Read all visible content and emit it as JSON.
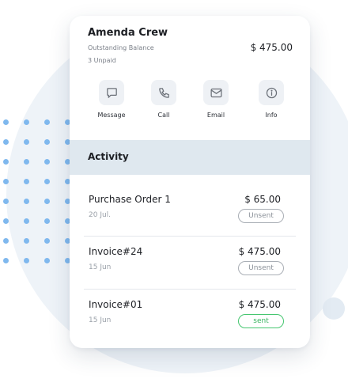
{
  "customer": {
    "name": "Amenda Crew",
    "outstanding_label": "Outstanding Balance",
    "unpaid_label": "3 Unpaid",
    "balance": "$ 475.00"
  },
  "actions": [
    {
      "label": "Message",
      "icon": "message-icon"
    },
    {
      "label": "Call",
      "icon": "phone-icon"
    },
    {
      "label": "Email",
      "icon": "envelope-icon"
    },
    {
      "label": "Info",
      "icon": "info-icon"
    }
  ],
  "activity": {
    "title": "Activity",
    "items": [
      {
        "title": "Purchase Order 1",
        "date": "20 Jul.",
        "amount": "$ 65.00",
        "status": "Unsent"
      },
      {
        "title": "Invoice#24",
        "date": "15 Jun",
        "amount": "$ 475.00",
        "status": "Unsent"
      },
      {
        "title": "Invoice#01",
        "date": "15 Jun",
        "amount": "$ 475.00",
        "status": "sent"
      }
    ]
  },
  "colors": {
    "accent_dots": "#7fb8ee",
    "activity_header_bg": "#dfe8ef",
    "sent_green": "#45c66f"
  }
}
